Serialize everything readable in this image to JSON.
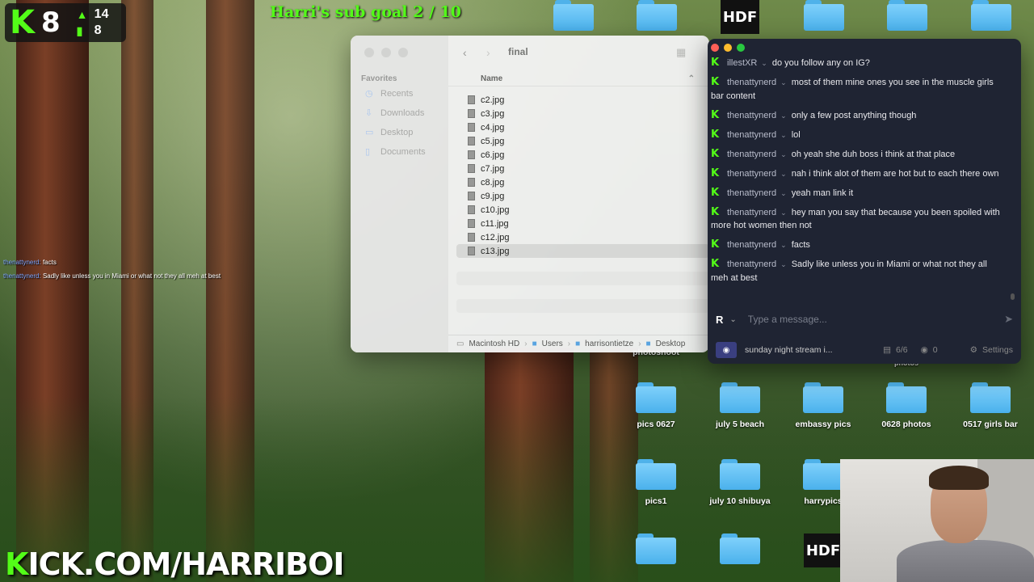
{
  "overlay": {
    "kick_logo": "K",
    "follower_count": "8",
    "stat_up": "14",
    "stat_bars": "8",
    "sub_goal": "Harri's sub goal  2 / 10",
    "kick_url_k": "K",
    "kick_url_rest": "ICK.COM/HARRIBOI",
    "chat_preview": [
      {
        "user": "thenattynerd:",
        "text": "facts"
      },
      {
        "user": "thenattynerd:",
        "text": "Sadly like unless you in Miami or what not they all meh at best"
      }
    ]
  },
  "desktop": {
    "hdf_label": "HDF",
    "icons": [
      {
        "label": "photoshoot"
      },
      {
        "label": "photos"
      },
      {
        "label": "pics 0627"
      },
      {
        "label": "july 5 beach"
      },
      {
        "label": "embassy pics"
      },
      {
        "label": "0628 photos"
      },
      {
        "label": "0517 girls bar"
      },
      {
        "label": "pics1"
      },
      {
        "label": "july 10 shibuya"
      },
      {
        "label": "harrypics"
      }
    ]
  },
  "finder": {
    "title": "final",
    "sidebar_heading": "Favorites",
    "sidebar": [
      "Recents",
      "Downloads",
      "Desktop",
      "Documents"
    ],
    "column_name": "Name",
    "files": [
      "c2.jpg",
      "c3.jpg",
      "c4.jpg",
      "c5.jpg",
      "c6.jpg",
      "c7.jpg",
      "c8.jpg",
      "c9.jpg",
      "c10.jpg",
      "c11.jpg",
      "c12.jpg",
      "c13.jpg"
    ],
    "selected": "c13.jpg",
    "path": [
      "Macintosh HD",
      "Users",
      "harrisontietze",
      "Desktop"
    ]
  },
  "chat": {
    "messages": [
      {
        "user": "illestXR",
        "text": "do you follow any on IG?"
      },
      {
        "user": "thenattynerd",
        "text": "most of them mine ones you see in the muscle girls bar content"
      },
      {
        "user": "thenattynerd",
        "text": "only a few post anything though"
      },
      {
        "user": "thenattynerd",
        "text": "lol"
      },
      {
        "user": "thenattynerd",
        "text": "oh yeah she duh boss i think at that place"
      },
      {
        "user": "thenattynerd",
        "text": "nah i think alot of them are hot but to each there own"
      },
      {
        "user": "thenattynerd",
        "text": "yeah man link it"
      },
      {
        "user": "thenattynerd",
        "text": "hey man you say that because you been spoiled with more hot women then not"
      },
      {
        "user": "thenattynerd",
        "text": "facts"
      },
      {
        "user": "thenattynerd",
        "text": "Sadly like unless you in Miami or what not they all meh at best"
      }
    ],
    "avatar_letter": "R",
    "input_placeholder": "Type a message...",
    "stream_title": "sunday night stream i...",
    "viewers": "6/6",
    "watching": "0",
    "settings_label": "Settings"
  }
}
